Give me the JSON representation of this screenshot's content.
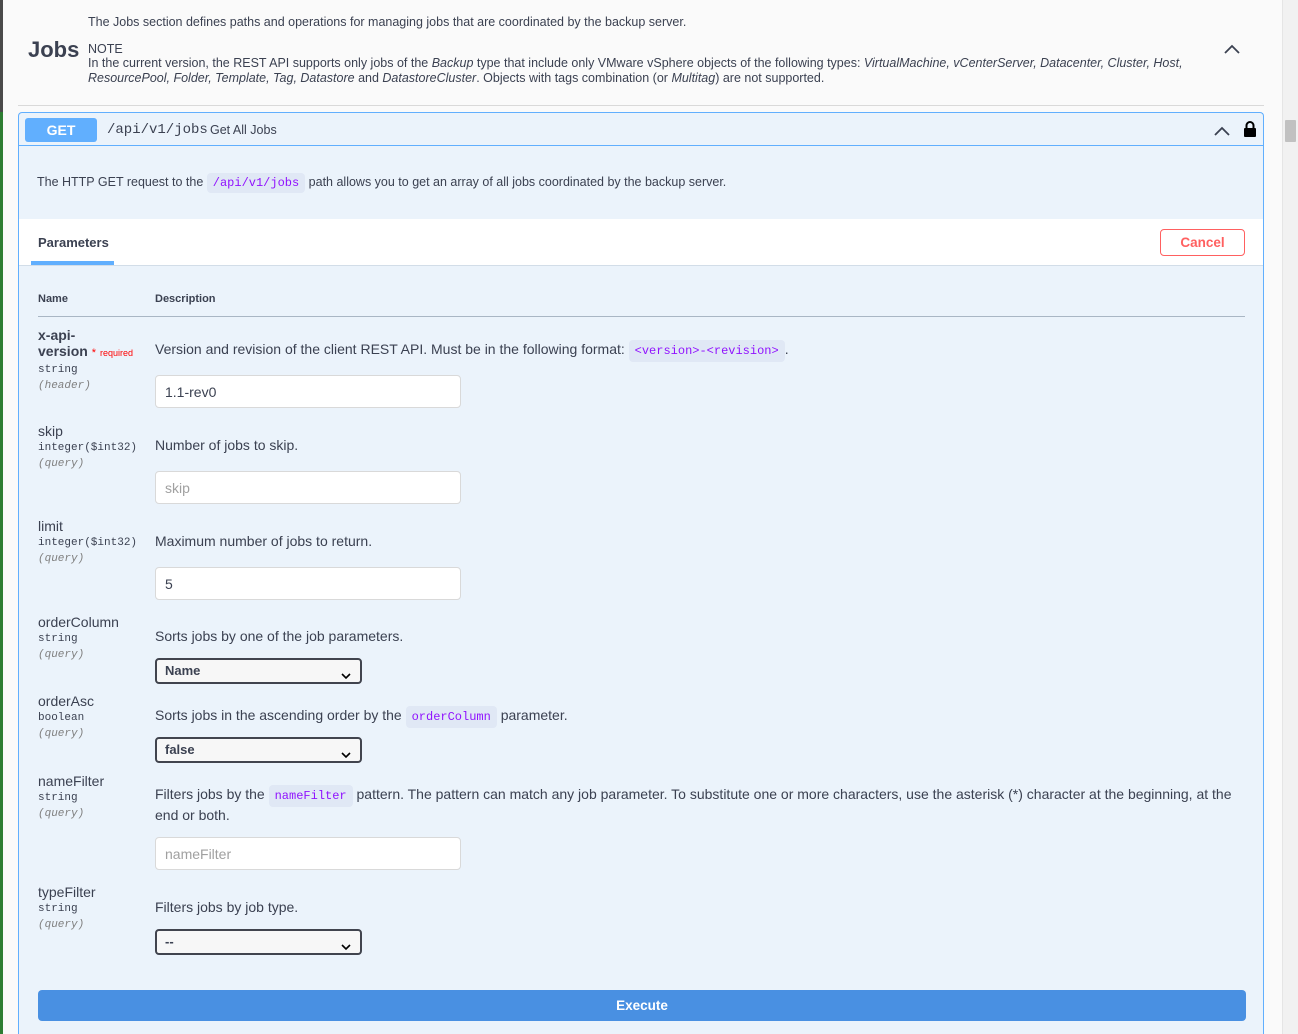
{
  "tag": {
    "title": "Jobs",
    "intro": "The Jobs section defines paths and operations for managing jobs that are coordinated by the backup server.",
    "note_label": "NOTE",
    "note_text_parts": {
      "p1": "In the current version, the REST API supports only jobs of the ",
      "backup": "Backup",
      "p2": " type that include only VMware vSphere objects of the following types: ",
      "types": "VirtualMachine, vCenterServer, Datacenter, Cluster, Host, ResourcePool, Folder, Template, Tag, Datastore",
      "p3": " and ",
      "dscluster": "DatastoreCluster",
      "p4": ". Objects with tags combination (or ",
      "multitag": "Multitag",
      "p5": ") are not supported."
    },
    "toggle_icon": "chevron-up-icon"
  },
  "operation": {
    "method": "GET",
    "path": "/api/v1/jobs",
    "summary": "Get All Jobs",
    "description_before": "The HTTP GET request to the ",
    "description_code": "/api/v1/jobs",
    "description_after": " path allows you to get an array of all jobs coordinated by the backup server.",
    "accent_color": "#61affe"
  },
  "parameters_tab": {
    "label": "Parameters",
    "cancel_label": "Cancel",
    "col_name": "Name",
    "col_description": "Description"
  },
  "params": {
    "xapi": {
      "name_line1": "x-api-",
      "name_line2": "version",
      "required_star": "*",
      "required_text": "required",
      "type": "string",
      "in": "(header)",
      "desc_before": "Version and revision of the client REST API. Must be in the following format: ",
      "desc_code": "<version>-<revision>",
      "desc_after": ".",
      "value": "1.1-rev0"
    },
    "skip": {
      "name": "skip",
      "type": "integer($int32)",
      "in": "(query)",
      "desc": "Number of jobs to skip.",
      "placeholder": "skip"
    },
    "limit": {
      "name": "limit",
      "type": "integer($int32)",
      "in": "(query)",
      "desc": "Maximum number of jobs to return.",
      "value": "5"
    },
    "orderColumn": {
      "name": "orderColumn",
      "type": "string",
      "in": "(query)",
      "desc": "Sorts jobs by one of the job parameters.",
      "selected": "Name"
    },
    "orderAsc": {
      "name": "orderAsc",
      "type": "boolean",
      "in": "(query)",
      "desc_before": "Sorts jobs in the ascending order by the ",
      "desc_code": "orderColumn",
      "desc_after": " parameter.",
      "selected": "false"
    },
    "nameFilter": {
      "name": "nameFilter",
      "type": "string",
      "in": "(query)",
      "desc_before": "Filters jobs by the ",
      "desc_code": "nameFilter",
      "desc_after": " pattern. The pattern can match any job parameter. To substitute one or more characters, use the asterisk (*) character at the beginning, at the end or both.",
      "placeholder": "nameFilter"
    },
    "typeFilter": {
      "name": "typeFilter",
      "type": "string",
      "in": "(query)",
      "desc": "Filters jobs by job type.",
      "selected": "--"
    }
  },
  "execute_label": "Execute"
}
